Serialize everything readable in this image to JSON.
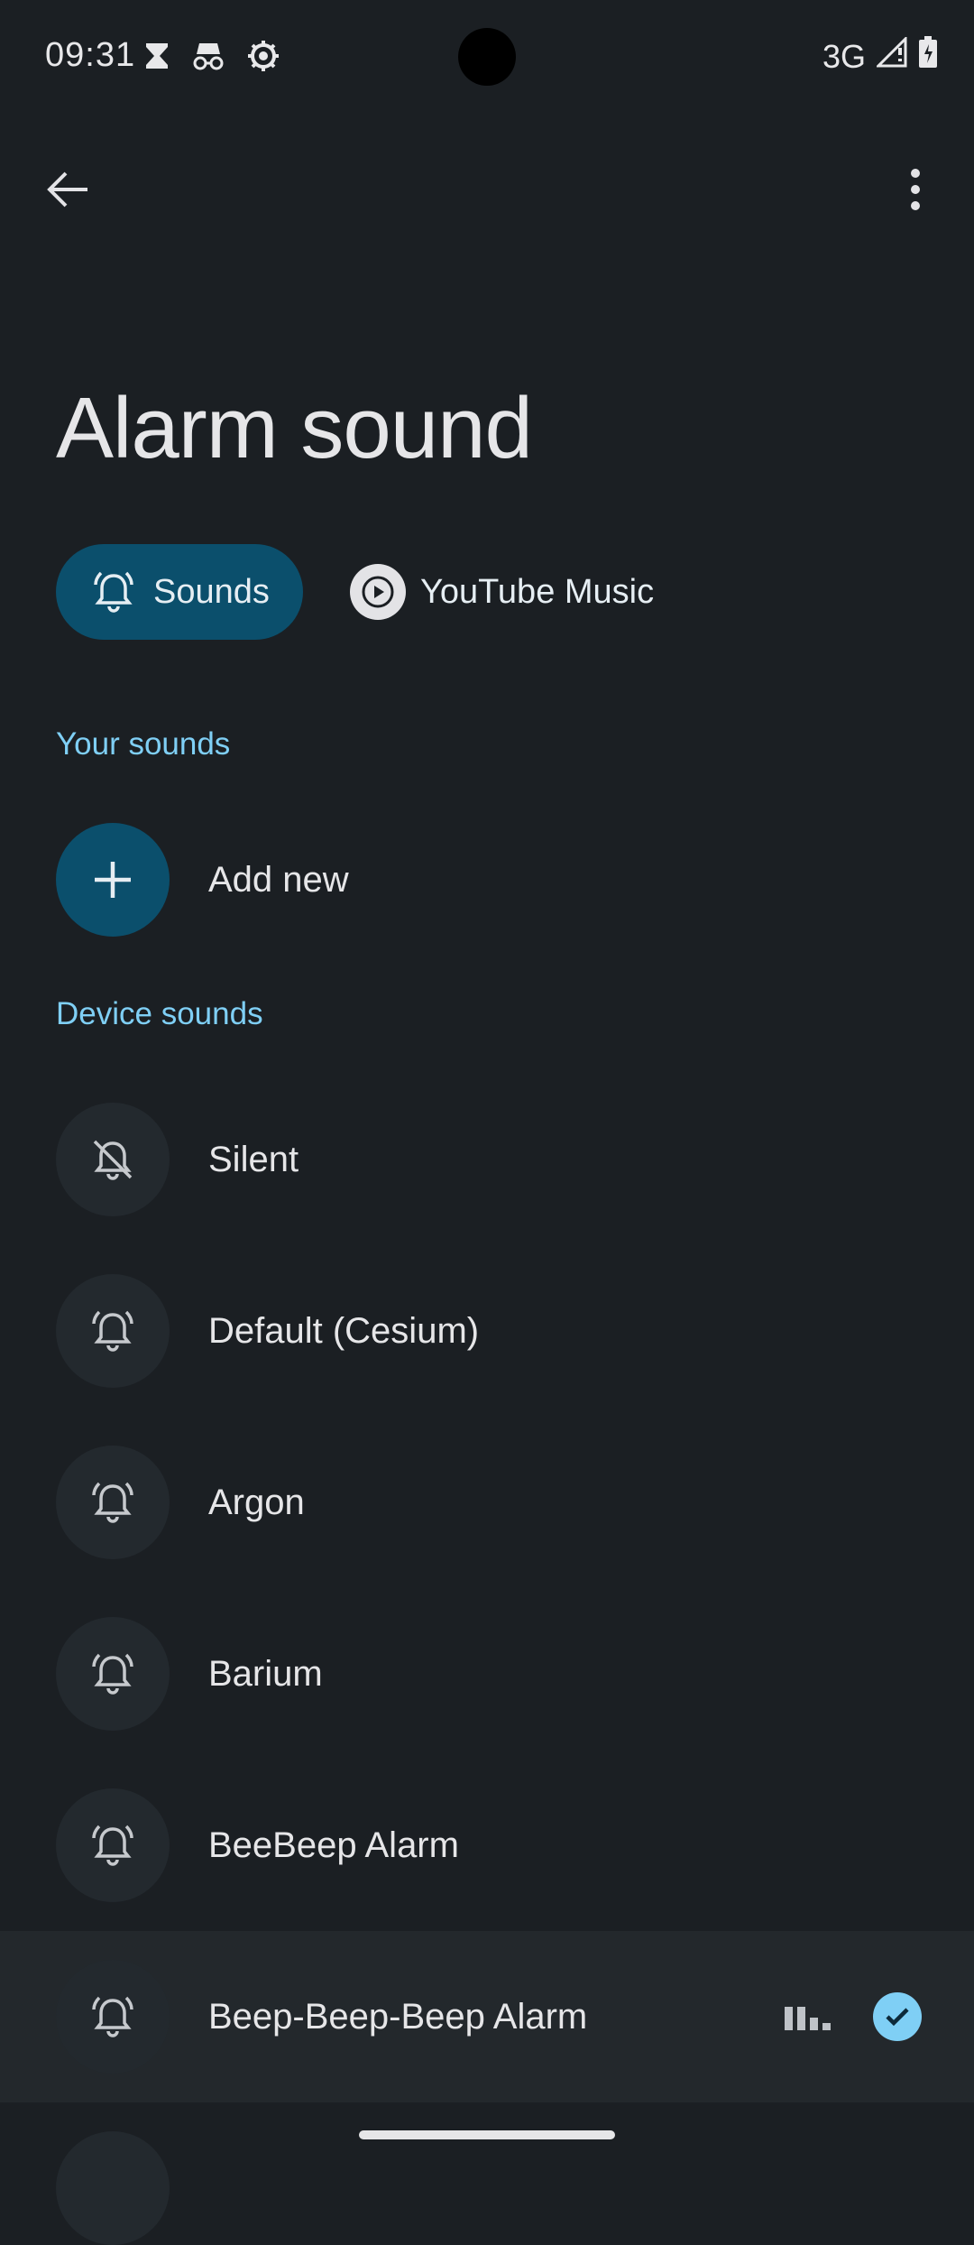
{
  "status_bar": {
    "time": "09:31",
    "network": "3G",
    "icons_left": [
      "hourglass-icon",
      "incognito-icon",
      "settings-icon"
    ],
    "icons_right": [
      "signal-icon",
      "battery-charging-icon"
    ]
  },
  "app_bar": {
    "back_icon": "arrow-back-icon",
    "menu_icon": "more-vert-icon"
  },
  "page": {
    "title": "Alarm sound"
  },
  "tabs": {
    "sounds_label": "Sounds",
    "youtube_music_label": "YouTube Music",
    "selected": "Sounds"
  },
  "sections": {
    "your_sounds": "Your sounds",
    "device_sounds": "Device sounds"
  },
  "your_sounds": {
    "add_new_label": "Add new"
  },
  "device_sounds": [
    {
      "label": "Silent",
      "icon": "alarm-off-icon",
      "selected": false
    },
    {
      "label": "Default (Cesium)",
      "icon": "alarm-bell-icon",
      "selected": false
    },
    {
      "label": "Argon",
      "icon": "alarm-bell-icon",
      "selected": false
    },
    {
      "label": "Barium",
      "icon": "alarm-bell-icon",
      "selected": false
    },
    {
      "label": "BeeBeep Alarm",
      "icon": "alarm-bell-icon",
      "selected": false
    },
    {
      "label": "Beep-Beep-Beep Alarm",
      "icon": "alarm-bell-icon",
      "selected": true
    }
  ],
  "colors": {
    "background": "#1b1f23",
    "accent": "#7fcff5",
    "chip_selected": "#0b4f6c",
    "icon_circle": "#23292e",
    "selected_row": "#23282c"
  }
}
